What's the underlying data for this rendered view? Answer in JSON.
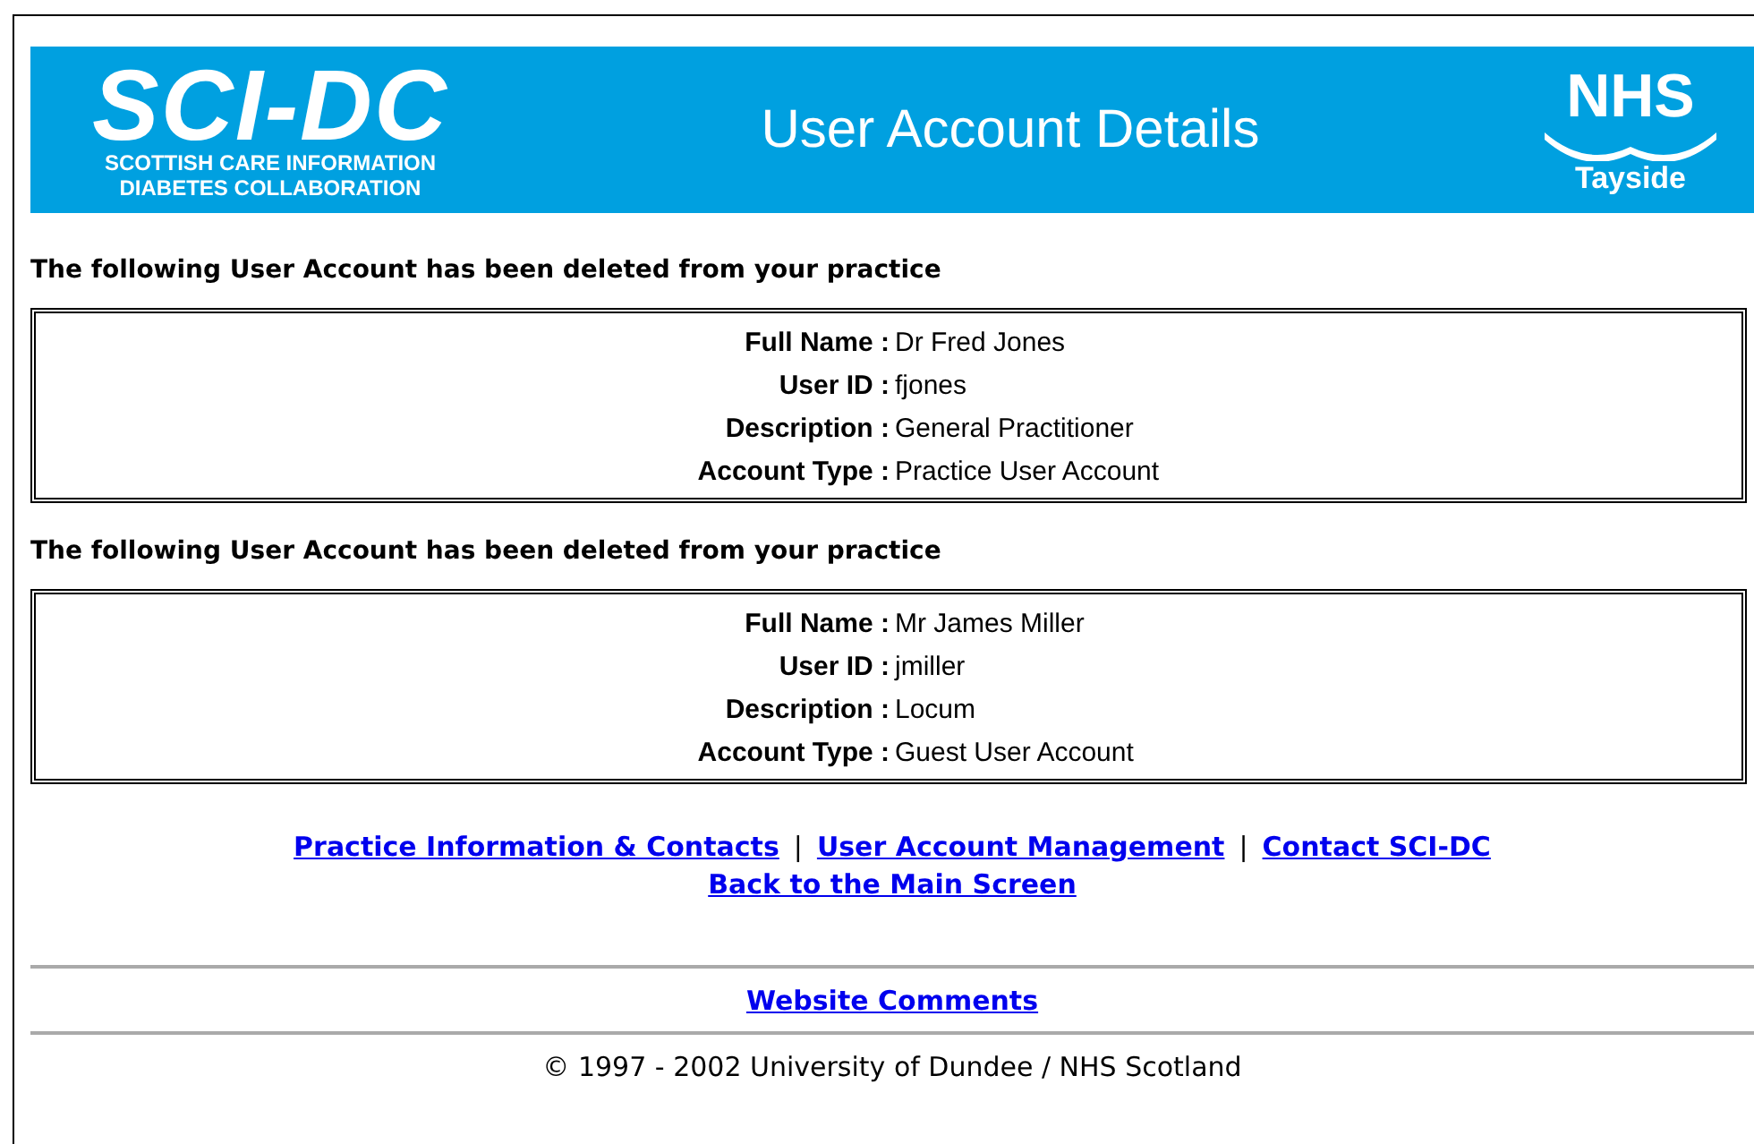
{
  "header": {
    "logo": {
      "name": "SCI-DC",
      "line_1": "SCOTTISH CARE INFORMATION",
      "line_2": "DIABETES COLLABORATION"
    },
    "title": "User Account Details",
    "nhs_logo": {
      "name": "NHS",
      "region": "Tayside"
    }
  },
  "accounts": [
    {
      "notice": "The following User Account has been deleted from your practice",
      "fields": [
        {
          "label": "Full Name :",
          "value": "Dr Fred Jones"
        },
        {
          "label": "User ID :",
          "value": "fjones"
        },
        {
          "label": "Description :",
          "value": "General Practitioner"
        },
        {
          "label": "Account Type :",
          "value": "Practice User Account"
        }
      ]
    },
    {
      "notice": "The following User Account has been deleted from your practice",
      "fields": [
        {
          "label": "Full Name :",
          "value": "Mr James Miller"
        },
        {
          "label": "User ID :",
          "value": "jmiller"
        },
        {
          "label": "Description :",
          "value": "Locum"
        },
        {
          "label": "Account Type :",
          "value": "Guest User Account"
        }
      ]
    }
  ],
  "nav_links": [
    "Practice Information & Contacts",
    "User Account Management",
    "Contact SCI-DC"
  ],
  "separator": "|",
  "back_link": "Back to the Main Screen",
  "comments_link": "Website Comments",
  "copyright": "© 1997 - 2002 University of Dundee / NHS Scotland"
}
